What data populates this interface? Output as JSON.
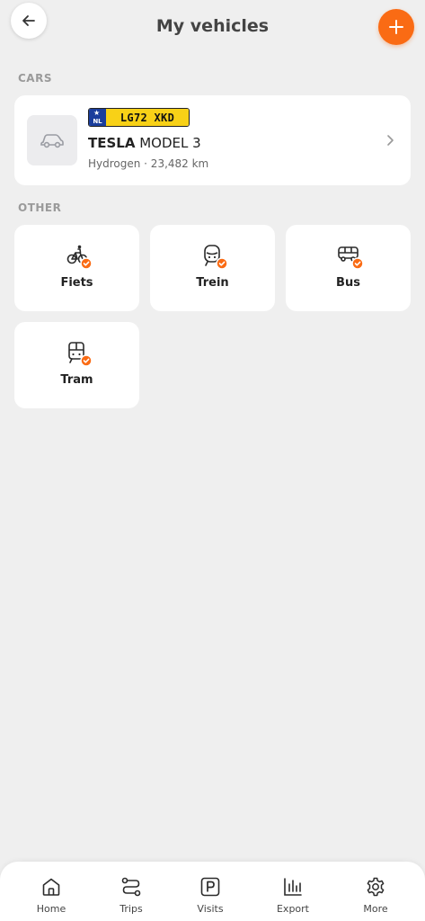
{
  "header": {
    "title": "My vehicles",
    "back_icon": "arrow-left-icon",
    "add_icon": "plus-icon"
  },
  "sections": {
    "cars_label": "CARS",
    "other_label": "OTHER"
  },
  "car": {
    "plate_country": "NL",
    "plate_number": "LG72 XKD",
    "make": "TESLA",
    "model": "MODEL 3",
    "meta": "Hydrogen · 23,482 km",
    "icon": "car-icon"
  },
  "other_vehicles": [
    {
      "label": "Fiets",
      "icon": "bicycle-icon",
      "selected": true
    },
    {
      "label": "Trein",
      "icon": "train-icon",
      "selected": true
    },
    {
      "label": "Bus",
      "icon": "bus-icon",
      "selected": true
    },
    {
      "label": "Tram",
      "icon": "tram-icon",
      "selected": true
    }
  ],
  "nav": [
    {
      "label": "Home",
      "icon": "home-icon"
    },
    {
      "label": "Trips",
      "icon": "route-icon"
    },
    {
      "label": "Visits",
      "icon": "parking-icon"
    },
    {
      "label": "Export",
      "icon": "bar-chart-icon"
    },
    {
      "label": "More",
      "icon": "gear-icon"
    }
  ],
  "colors": {
    "accent": "#fa6b14",
    "plate_yellow": "#f8d117",
    "plate_blue": "#1a3d9c",
    "background": "#efefef"
  }
}
